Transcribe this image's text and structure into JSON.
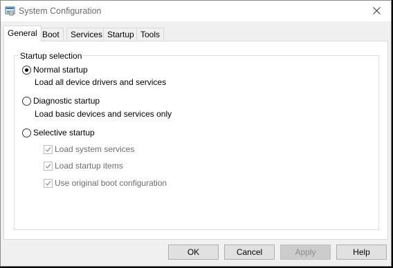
{
  "window": {
    "title": "System Configuration"
  },
  "icons": {
    "app": "msconfig-icon",
    "close": "close-icon",
    "check": "checkmark-icon"
  },
  "tabs": [
    {
      "label": "General",
      "active": true
    },
    {
      "label": "Boot",
      "active": false
    },
    {
      "label": "Services",
      "active": false
    },
    {
      "label": "Startup",
      "active": false
    },
    {
      "label": "Tools",
      "active": false
    }
  ],
  "startup_selection": {
    "legend": "Startup selection",
    "options": [
      {
        "label": "Normal startup",
        "description": "Load all device drivers and services",
        "selected": true
      },
      {
        "label": "Diagnostic startup",
        "description": "Load basic devices and services only",
        "selected": false
      },
      {
        "label": "Selective startup",
        "description": "",
        "selected": false
      }
    ],
    "selective_items": [
      {
        "label": "Load system services",
        "checked": true,
        "enabled": false
      },
      {
        "label": "Load startup items",
        "checked": true,
        "enabled": false
      },
      {
        "label": "Use original boot configuration",
        "checked": true,
        "enabled": false
      }
    ]
  },
  "buttons": {
    "ok": "OK",
    "cancel": "Cancel",
    "apply": "Apply",
    "help": "Help",
    "apply_enabled": false
  },
  "colors": {
    "window_bg": "#f0f0f0",
    "panel_bg": "#ffffff",
    "disabled_text": "#6d6d6d"
  }
}
